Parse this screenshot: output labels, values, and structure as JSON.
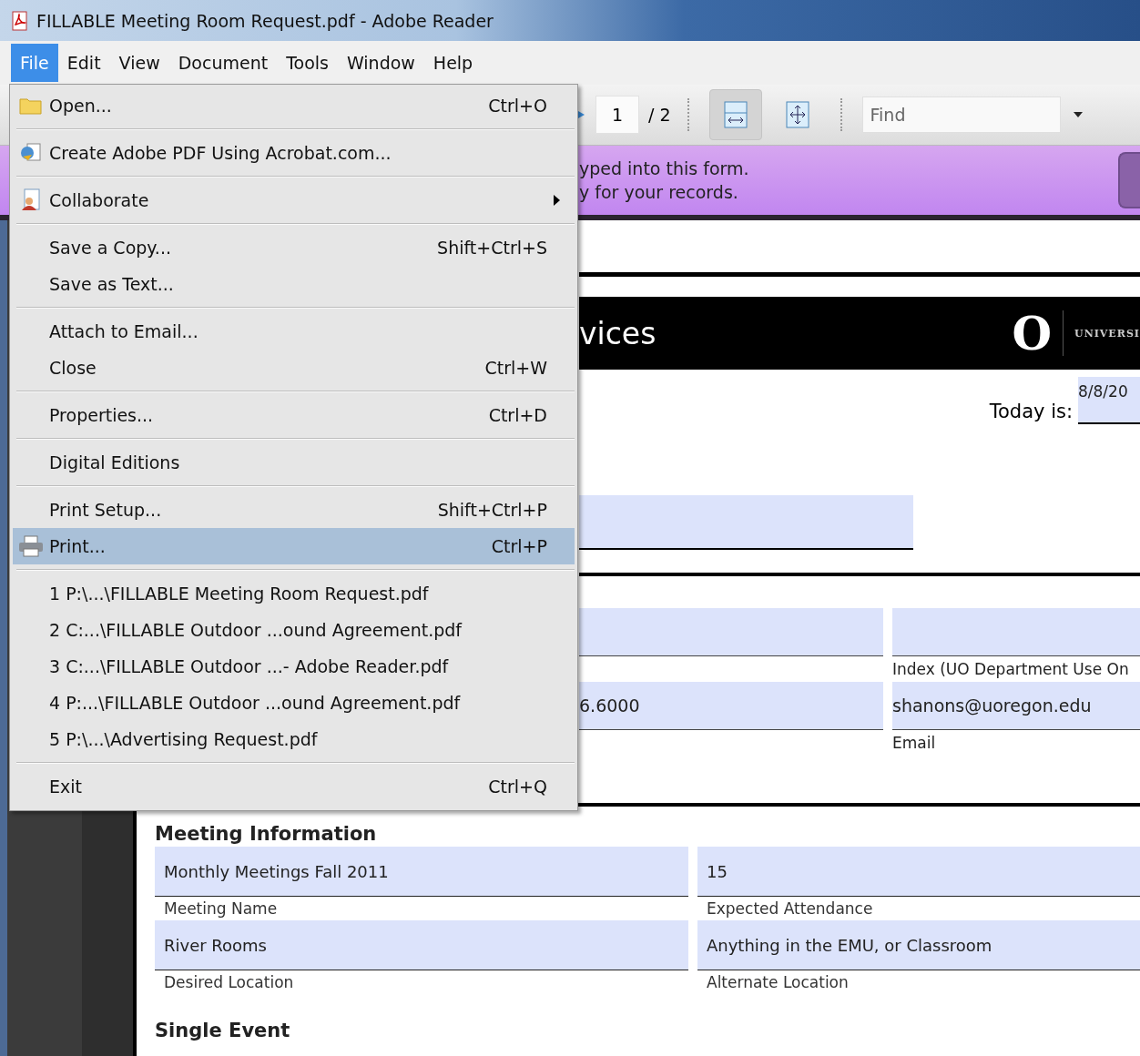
{
  "window": {
    "title": "FILLABLE Meeting Room Request.pdf - Adobe Reader"
  },
  "menu_bar": [
    {
      "label": "File",
      "selected": true
    },
    {
      "label": "Edit",
      "selected": false
    },
    {
      "label": "View",
      "selected": false
    },
    {
      "label": "Document",
      "selected": false
    },
    {
      "label": "Tools",
      "selected": false
    },
    {
      "label": "Window",
      "selected": false
    },
    {
      "label": "Help",
      "selected": false
    }
  ],
  "file_menu": {
    "groups": [
      [
        {
          "label": "Open...",
          "shortcut": "Ctrl+O",
          "submenu": false,
          "selected": false
        }
      ],
      [
        {
          "label": "Create Adobe PDF Using Acrobat.com...",
          "submenu": false,
          "selected": false
        }
      ],
      [
        {
          "label": "Collaborate",
          "submenu": true,
          "selected": false
        }
      ],
      [
        {
          "label": "Save a Copy...",
          "shortcut": "Shift+Ctrl+S",
          "submenu": false,
          "selected": false
        },
        {
          "label": "Save as Text...",
          "submenu": false,
          "selected": false
        }
      ],
      [
        {
          "label": "Attach to Email...",
          "submenu": false,
          "selected": false
        },
        {
          "label": "Close",
          "shortcut": "Ctrl+W",
          "submenu": false,
          "selected": false
        }
      ],
      [
        {
          "label": "Properties...",
          "shortcut": "Ctrl+D",
          "submenu": false,
          "selected": false
        }
      ],
      [
        {
          "label": "Digital Editions",
          "submenu": false,
          "selected": false
        }
      ],
      [
        {
          "label": "Print Setup...",
          "shortcut": "Shift+Ctrl+P",
          "submenu": false,
          "selected": false
        },
        {
          "label": "Print...",
          "shortcut": "Ctrl+P",
          "submenu": false,
          "selected": true
        }
      ],
      [
        {
          "label": "1 P:\\...\\FILLABLE Meeting Room Request.pdf",
          "submenu": false,
          "selected": false
        },
        {
          "label": "2 C:...\\FILLABLE Outdoor ...ound Agreement.pdf",
          "submenu": false,
          "selected": false
        },
        {
          "label": "3 C:...\\FILLABLE Outdoor ...- Adobe Reader.pdf",
          "submenu": false,
          "selected": false
        },
        {
          "label": "4 P:...\\FILLABLE Outdoor ...ound Agreement.pdf",
          "submenu": false,
          "selected": false
        },
        {
          "label": "5 P:\\...\\Advertising Request.pdf",
          "submenu": false,
          "selected": false
        }
      ],
      [
        {
          "label": "Exit",
          "shortcut": "Ctrl+Q",
          "submenu": false,
          "selected": false
        }
      ]
    ]
  },
  "toolbar": {
    "page_number": "1",
    "page_count": "/ 2",
    "view_buttons": [
      {
        "selected": true
      },
      {
        "selected": false
      }
    ],
    "find": {
      "placeholder": "Find"
    }
  },
  "form_banner": {
    "lines": [
      "yped into this form.",
      "y for your records."
    ]
  },
  "document": {
    "header_title": "vices",
    "logo_mark": "O",
    "logo_text": "UNIVERSI",
    "today_label": "Today is:",
    "today_value": "8/8/20",
    "contact_fields": [
      {
        "kind": "field"
      },
      {
        "kind": "field",
        "label": "Index (UO Department Use On"
      },
      {
        "kind": "field",
        "value": "6.6000"
      },
      {
        "kind": "field",
        "value": "shanons@uoregon.edu",
        "label": "Email"
      }
    ],
    "meeting": {
      "heading": "Meeting Information",
      "fields": [
        {
          "value": "Monthly Meetings Fall 2011",
          "label": "Meeting Name"
        },
        {
          "value": "15",
          "label": "Expected Attendance"
        },
        {
          "value": "River Rooms",
          "label": "Desired Location"
        },
        {
          "value": "Anything in the EMU, or Classroom",
          "label": "Alternate Location"
        }
      ]
    },
    "next_heading": "Single Event"
  }
}
